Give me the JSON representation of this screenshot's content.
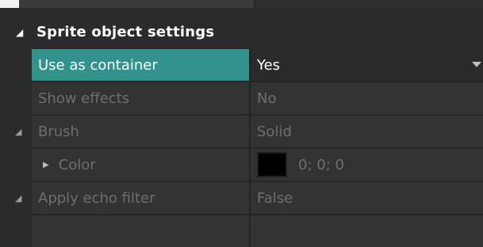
{
  "section": {
    "title": "Sprite object settings"
  },
  "properties": [
    {
      "label": "Use as container",
      "value": "Yes"
    },
    {
      "label": "Show effects",
      "value": "No"
    },
    {
      "label": "Brush",
      "value": "Solid"
    },
    {
      "label": "Color",
      "value": "0; 0; 0",
      "swatch": "#000000"
    },
    {
      "label": "Apply echo filter",
      "value": "False"
    }
  ],
  "colors": {
    "selected_accent": "#33928c",
    "background": "#2b2b2b",
    "disabled_text": "#6e6e6e"
  }
}
